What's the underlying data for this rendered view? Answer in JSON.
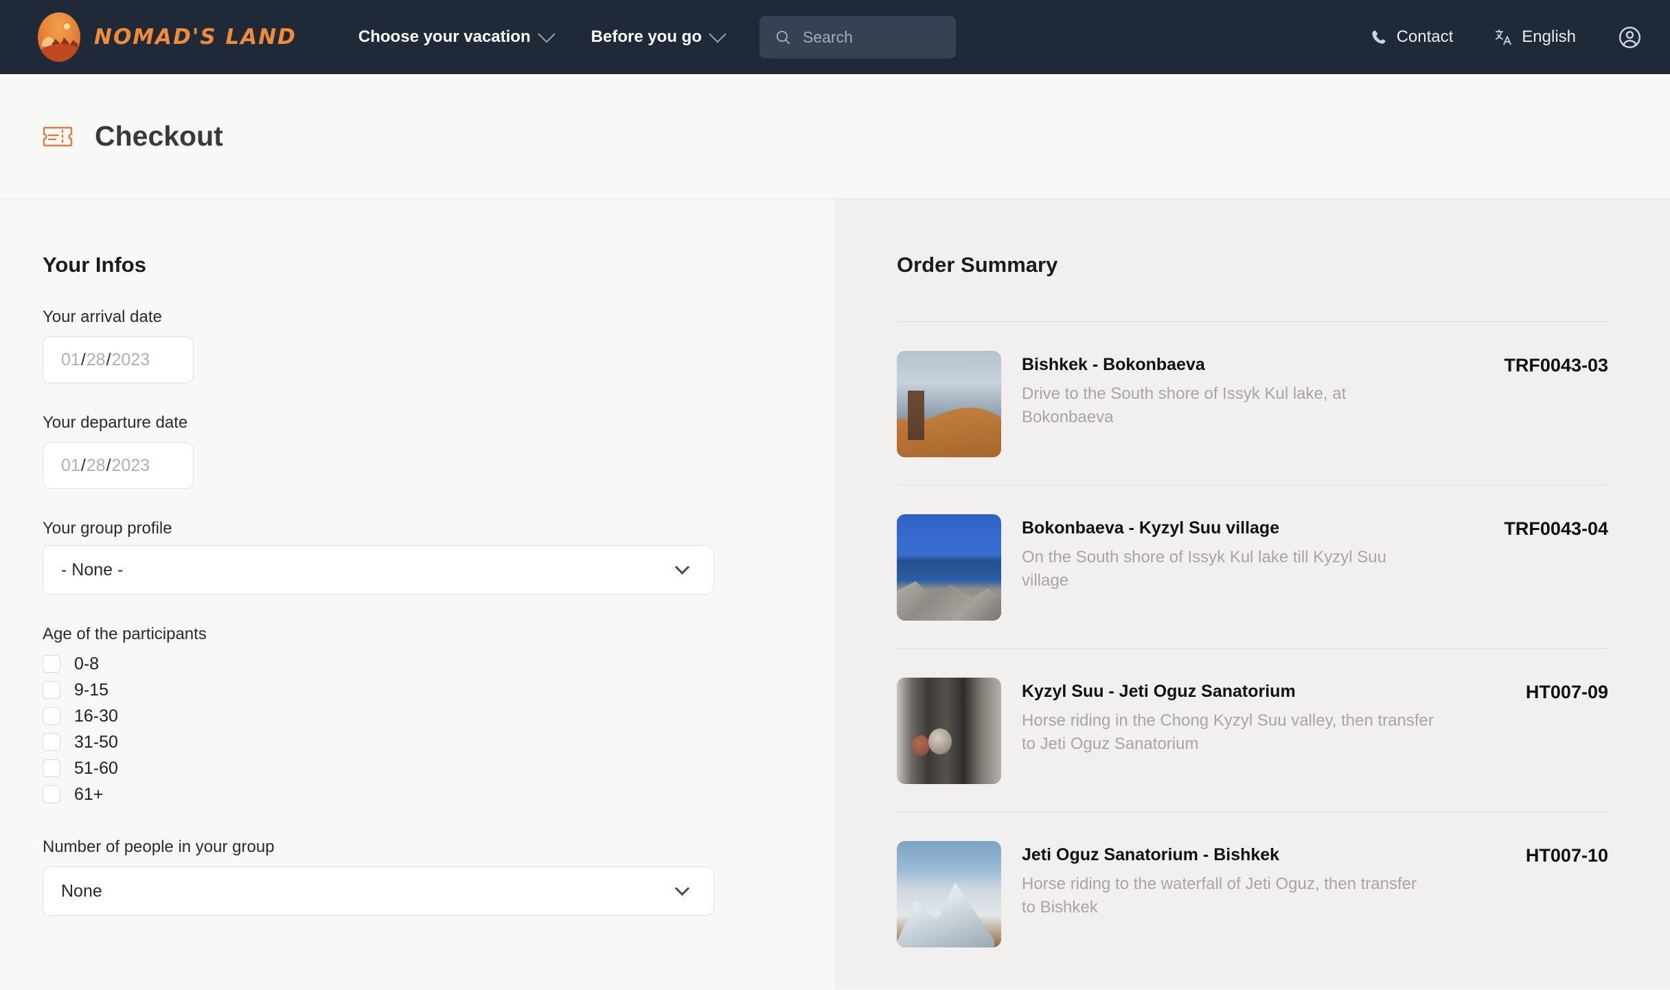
{
  "navbar": {
    "brand_name": "NOMAD'S LAND",
    "links": [
      {
        "label": "Choose your vacation",
        "icon": "chevron-down-icon"
      },
      {
        "label": "Before you go",
        "icon": "chevron-down-icon"
      }
    ],
    "search": {
      "placeholder": "Search",
      "value": "",
      "icon": "search-icon"
    },
    "contact": {
      "label": "Contact",
      "icon": "phone-icon"
    },
    "language": {
      "label": "English",
      "icon": "translate-icon"
    },
    "account": {
      "icon": "user-avatar-icon"
    }
  },
  "page": {
    "title": "Checkout",
    "title_icon": "ticket-icon"
  },
  "form": {
    "section_title": "Your Infos",
    "arrival": {
      "label": "Your arrival date",
      "month": "01",
      "day": "28",
      "year": "2023",
      "separator": "/"
    },
    "departure": {
      "label": "Your departure date",
      "month": "01",
      "day": "28",
      "year": "2023",
      "separator": "/"
    },
    "group_profile": {
      "label": "Your group profile",
      "value": "- None -",
      "icon": "chevron-down-icon"
    },
    "ages": {
      "label": "Age of the participants",
      "options": [
        {
          "label": "0-8",
          "checked": false
        },
        {
          "label": "9-15",
          "checked": false
        },
        {
          "label": "16-30",
          "checked": false
        },
        {
          "label": "31-50",
          "checked": false
        },
        {
          "label": "51-60",
          "checked": false
        },
        {
          "label": "61+",
          "checked": false
        }
      ]
    },
    "group_size": {
      "label": "Number of people in your group",
      "value": "None",
      "icon": "chevron-down-icon"
    }
  },
  "order_summary": {
    "title": "Order Summary",
    "items": [
      {
        "title": "Bishkek - Bokonbaeva",
        "description": "Drive to the South shore of Issyk Kul lake, at Bokonbaeva",
        "code": "TRF0043-03",
        "thumbnail": "stone-tower-on-orange-hill"
      },
      {
        "title": "Bokonbaeva - Kyzyl Suu village",
        "description": "On the South shore of Issyk Kul lake till Kyzyl Suu village",
        "code": "TRF0043-04",
        "thumbnail": "blue-lake-with-grey-rocks"
      },
      {
        "title": "Kyzyl Suu - Jeti Oguz Sanatorium",
        "description": "Horse riding in the Chong Kyzyl Suu valley, then transfer to Jeti Oguz Sanatorium",
        "code": "HT007-09",
        "thumbnail": "riders-behind-dark-posts"
      },
      {
        "title": "Jeti Oguz Sanatorium - Bishkek",
        "description": "Horse riding to the waterfall of Jeti Oguz, then transfer to Bishkek",
        "code": "HT007-10",
        "thumbnail": "snowy-mountain-peak"
      }
    ]
  },
  "colors": {
    "navbar_bg": "#1f2937",
    "brand_orange": "#f08b3c",
    "left_panel_bg": "#f8f8f7",
    "right_panel_bg": "#f1f0ee",
    "muted_text": "#a8a5a1"
  }
}
